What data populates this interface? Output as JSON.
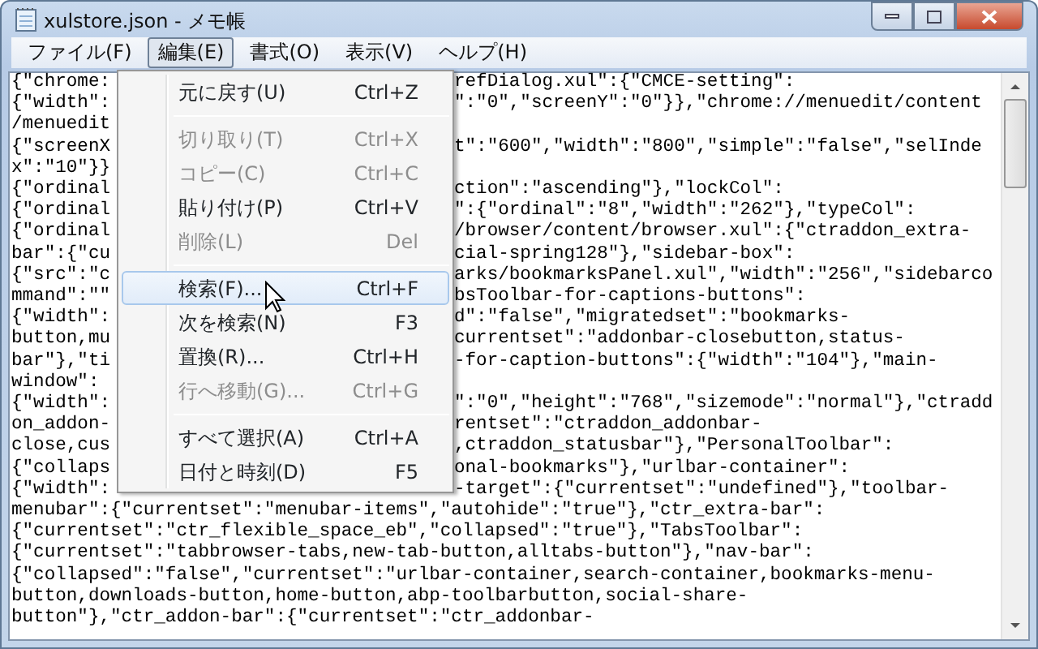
{
  "window": {
    "title": "xulstore.json - メモ帳"
  },
  "menubar": [
    {
      "label": "ファイル(F)",
      "selected": false
    },
    {
      "label": "編集(E)",
      "selected": true
    },
    {
      "label": "書式(O)",
      "selected": false
    },
    {
      "label": "表示(V)",
      "selected": false
    },
    {
      "label": "ヘルプ(H)",
      "selected": false
    }
  ],
  "edit_menu": [
    {
      "kind": "item",
      "label": "元に戻す(U)",
      "shortcut": "Ctrl+Z",
      "disabled": false,
      "selected": false
    },
    {
      "kind": "separator"
    },
    {
      "kind": "item",
      "label": "切り取り(T)",
      "shortcut": "Ctrl+X",
      "disabled": true,
      "selected": false
    },
    {
      "kind": "item",
      "label": "コピー(C)",
      "shortcut": "Ctrl+C",
      "disabled": true,
      "selected": false
    },
    {
      "kind": "item",
      "label": "貼り付け(P)",
      "shortcut": "Ctrl+V",
      "disabled": false,
      "selected": false
    },
    {
      "kind": "item",
      "label": "削除(L)",
      "shortcut": "Del",
      "disabled": true,
      "selected": false
    },
    {
      "kind": "separator"
    },
    {
      "kind": "item",
      "label": "検索(F)...",
      "shortcut": "Ctrl+F",
      "disabled": false,
      "selected": true
    },
    {
      "kind": "item",
      "label": "次を検索(N)",
      "shortcut": "F3",
      "disabled": false,
      "selected": false
    },
    {
      "kind": "item",
      "label": "置換(R)...",
      "shortcut": "Ctrl+H",
      "disabled": false,
      "selected": false
    },
    {
      "kind": "item",
      "label": "行へ移動(G)...",
      "shortcut": "Ctrl+G",
      "disabled": true,
      "selected": false
    },
    {
      "kind": "separator"
    },
    {
      "kind": "item",
      "label": "すべて選択(A)",
      "shortcut": "Ctrl+A",
      "disabled": false,
      "selected": false
    },
    {
      "kind": "item",
      "label": "日付と時刻(D)",
      "shortcut": "F5",
      "disabled": false,
      "selected": false
    }
  ],
  "editor_lines": [
    {
      "left": "{\"chrome:",
      "right": "refDialog.xul\":{\"CMCE-setting\":"
    },
    {
      "left": "{\"width\":",
      "right": "\":\"0\",\"screenY\":\"0\"}},\"chrome://menuedit/content"
    },
    {
      "left": "/menuedit"
    },
    {
      "left": "{\"screenX",
      "right": "t\":\"600\",\"width\":\"800\",\"simple\":\"false\",\"selInde"
    },
    {
      "left": "x\":\"10\"}}"
    },
    {
      "left": "{\"ordinal",
      "right": "ction\":\"ascending\"},\"lockCol\":"
    },
    {
      "left": "{\"ordinal",
      "right": "\":{\"ordinal\":\"8\",\"width\":\"262\"},\"typeCol\":"
    },
    {
      "left": "{\"ordinal",
      "right": "/browser/content/browser.xul\":{\"ctraddon_extra-"
    },
    {
      "left": "bar\":{\"cu",
      "right": "cial-spring128\"},\"sidebar-box\":"
    },
    {
      "left": "{\"src\":\"c",
      "right": "arks/bookmarksPanel.xul\",\"width\":\"256\",\"sidebarco"
    },
    {
      "left": "mmand\":\"\"",
      "right": "bsToolbar-for-captions-buttons\":"
    },
    {
      "left": "{\"width\":",
      "right": "d\":\"false\",\"migratedset\":\"bookmarks-"
    },
    {
      "left": "button,mu",
      "right": "currentset\":\"addonbar-closebutton,status-"
    },
    {
      "left": "bar\"},\"ti",
      "right": "-for-caption-buttons\":{\"width\":\"104\"},\"main-"
    },
    {
      "left": "window\":"
    },
    {
      "left": "{\"width\":",
      "right": "\":\"0\",\"height\":\"768\",\"sizemode\":\"normal\"},\"ctradd"
    },
    {
      "left": "on_addon-",
      "right": "rentset\":\"ctraddon_addonbar-"
    },
    {
      "left": "close,cus",
      "right": ",ctraddon_statusbar\"},\"PersonalToolbar\":"
    },
    {
      "left": "{\"collaps",
      "right": "onal-bookmarks\"},\"urlbar-container\":"
    },
    {
      "left": "{\"width\":",
      "right": "-target\":{\"currentset\":\"undefined\"},\"toolbar-"
    },
    {
      "left": "menubar\":{\"currentset\":\"menubar-items\",\"autohide\":\"true\"},\"ctr_extra-bar\":"
    },
    {
      "left": "{\"currentset\":\"ctr_flexible_space_eb\",\"collapsed\":\"true\"},\"TabsToolbar\":"
    },
    {
      "left": "{\"currentset\":\"tabbrowser-tabs,new-tab-button,alltabs-button\"},\"nav-bar\":"
    },
    {
      "left": "{\"collapsed\":\"false\",\"currentset\":\"urlbar-container,search-container,bookmarks-menu-"
    },
    {
      "left": "button,downloads-button,home-button,abp-toolbarbutton,social-share-"
    },
    {
      "left": "button\"},\"ctr_addon-bar\":{\"currentset\":\"ctr_addonbar-"
    }
  ]
}
